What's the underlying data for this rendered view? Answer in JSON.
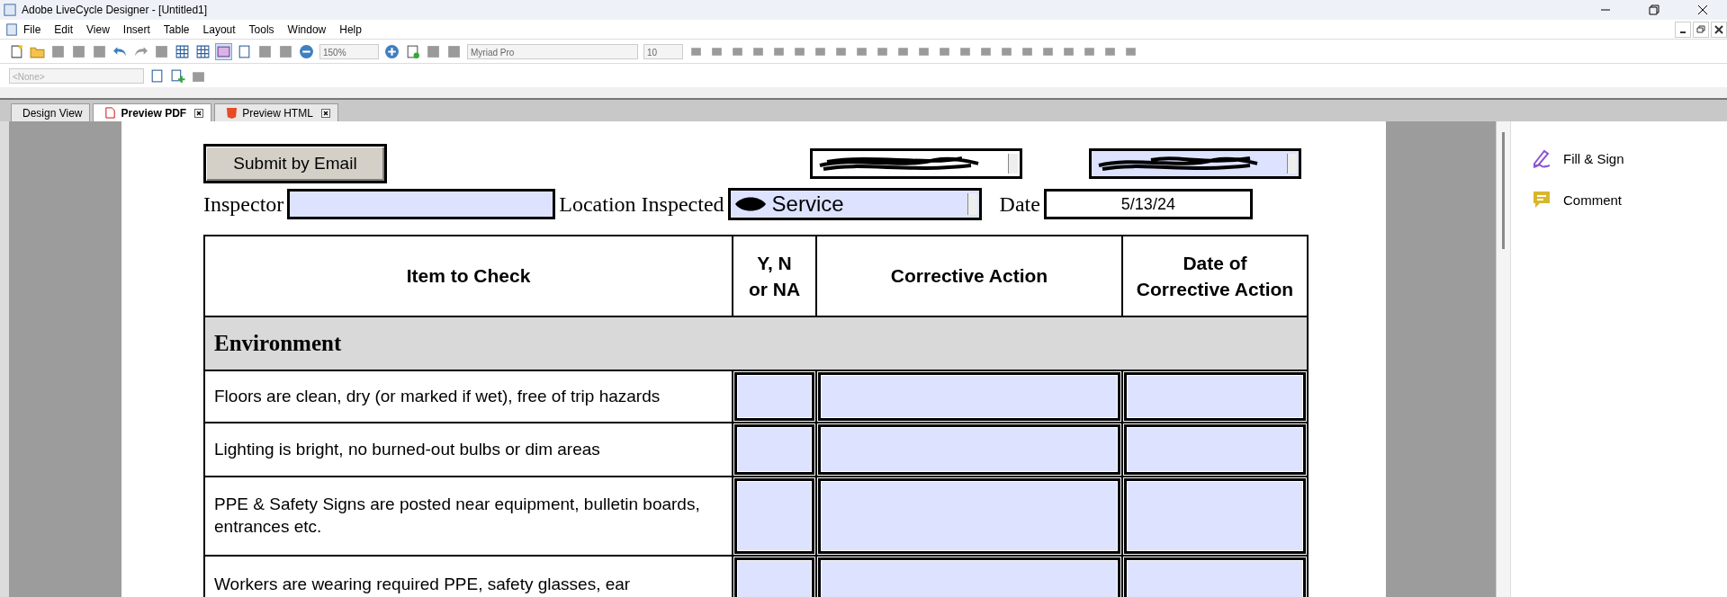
{
  "window": {
    "title": "Adobe LiveCycle Designer - [Untitled1]"
  },
  "menu": [
    "File",
    "Edit",
    "View",
    "Insert",
    "Table",
    "Layout",
    "Tools",
    "Window",
    "Help"
  ],
  "toolbar": {
    "zoom": "150%",
    "font": "Myriad Pro",
    "font_size": "10",
    "style": "<None>"
  },
  "tabs": [
    {
      "label": "Design View",
      "selected": false,
      "kind": "design"
    },
    {
      "label": "Preview PDF",
      "selected": true,
      "kind": "pdf"
    },
    {
      "label": "Preview HTML",
      "selected": false,
      "kind": "html"
    }
  ],
  "form": {
    "submit": "Submit by Email",
    "inspector_label": "Inspector",
    "location_label": "Location Inspected",
    "location_value": "Service",
    "date_label": "Date",
    "date_value": "5/13/24",
    "columns": [
      "Item to Check",
      "Y, N or NA",
      "Corrective Action",
      "Date of Corrective Action"
    ],
    "section": "Environment",
    "rows": [
      {
        "item": "Floors are clean, dry (or marked if wet), free of trip hazards"
      },
      {
        "item": "Lighting is bright, no burned-out bulbs or dim areas"
      },
      {
        "item": "PPE & Safety Signs are posted near equipment, bulletin boards, entrances etc."
      },
      {
        "item": "Workers are wearing required PPE, safety glasses, ear"
      }
    ]
  },
  "side_panel": [
    {
      "label": "Fill & Sign",
      "kind": "sign"
    },
    {
      "label": "Comment",
      "kind": "comment"
    }
  ]
}
